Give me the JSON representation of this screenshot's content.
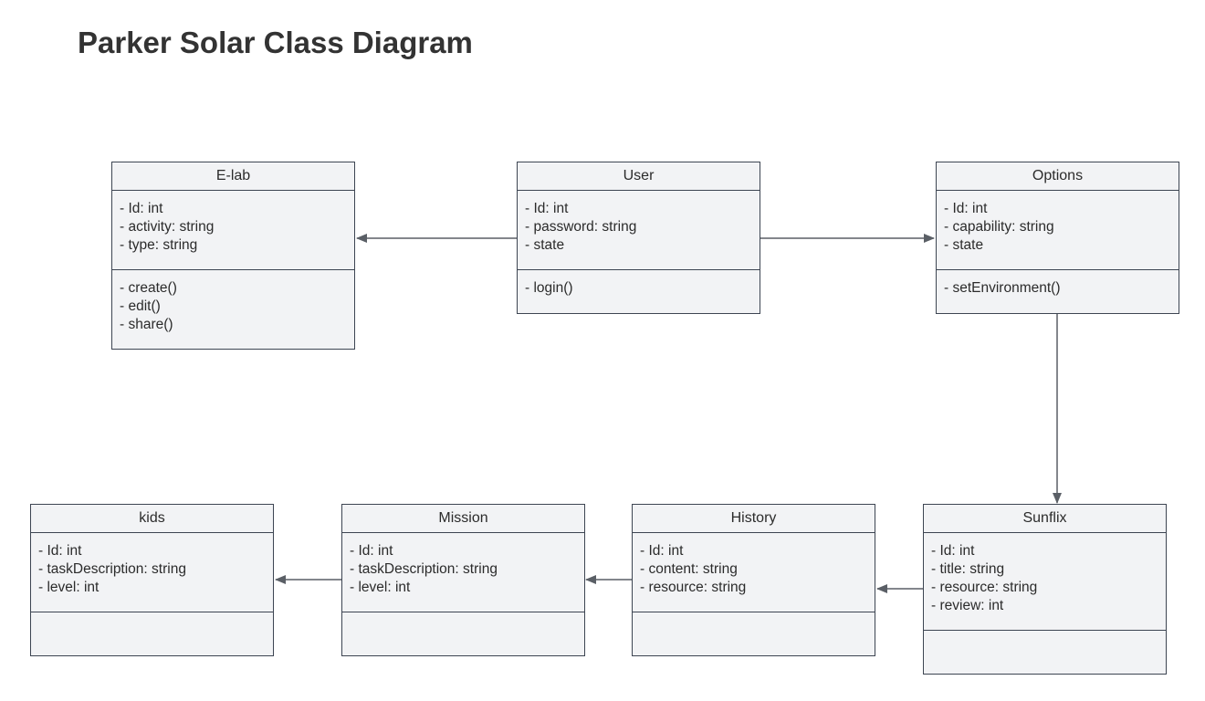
{
  "title": "Parker Solar Class Diagram",
  "classes": {
    "elab": {
      "name": "E-lab",
      "attributes": [
        "- Id: int",
        "- activity: string",
        "- type: string"
      ],
      "methods": [
        "- create()",
        "- edit()",
        "- share()"
      ]
    },
    "user": {
      "name": "User",
      "attributes": [
        "- Id: int",
        "- password: string",
        "- state"
      ],
      "methods": [
        "- login()"
      ]
    },
    "options": {
      "name": "Options",
      "attributes": [
        "- Id: int",
        "- capability: string",
        "- state"
      ],
      "methods": [
        "- setEnvironment()"
      ]
    },
    "kids": {
      "name": "kids",
      "attributes": [
        "- Id: int",
        "- taskDescription: string",
        "- level: int"
      ],
      "methods": []
    },
    "mission": {
      "name": "Mission",
      "attributes": [
        "- Id: int",
        "- taskDescription: string",
        "- level: int"
      ],
      "methods": []
    },
    "history": {
      "name": "History",
      "attributes": [
        "- Id: int",
        "- content: string",
        "- resource: string"
      ],
      "methods": []
    },
    "sunflix": {
      "name": "Sunflix",
      "attributes": [
        "- Id: int",
        "- title: string",
        "- resource: string",
        "- review: int"
      ],
      "methods": []
    }
  },
  "relations": [
    {
      "from": "User",
      "to": "E-lab"
    },
    {
      "from": "User",
      "to": "Options"
    },
    {
      "from": "Options",
      "to": "Sunflix"
    },
    {
      "from": "Sunflix",
      "to": "History"
    },
    {
      "from": "History",
      "to": "Mission"
    },
    {
      "from": "Mission",
      "to": "kids"
    }
  ],
  "colors": {
    "border": "#3d4552",
    "fill": "#f2f3f5",
    "connector": "#5a5f66",
    "title": "#333333"
  }
}
